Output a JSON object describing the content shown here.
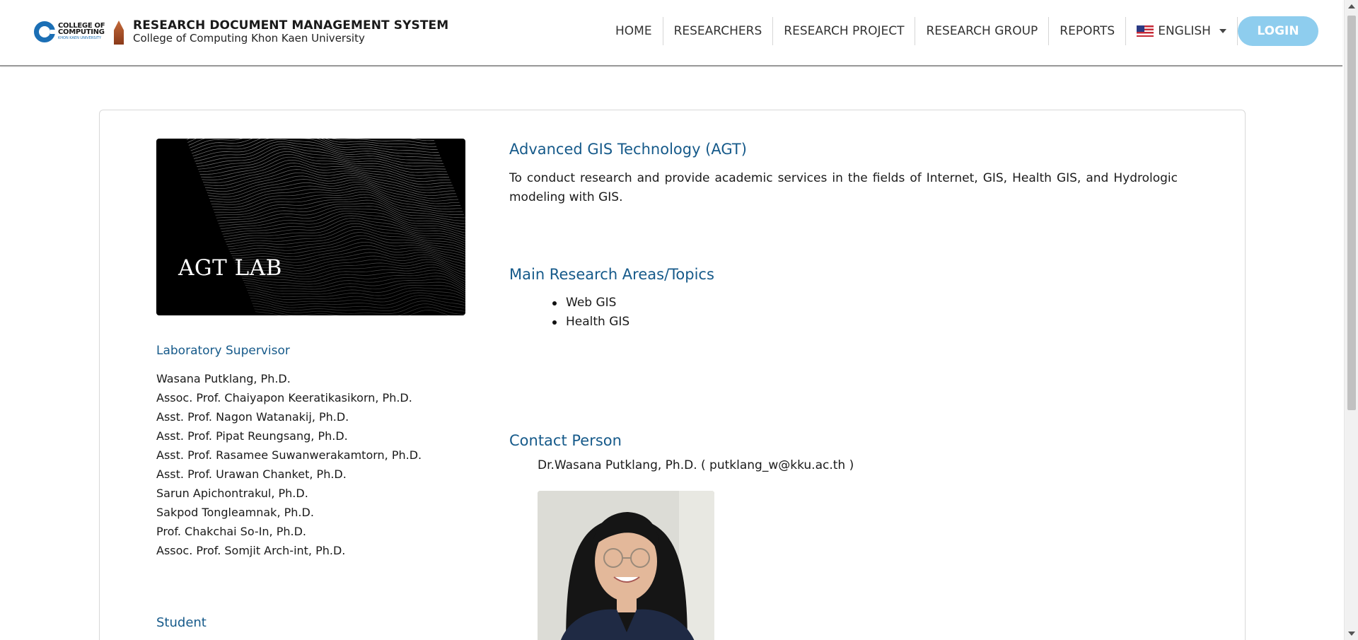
{
  "header": {
    "logo_line1": "COLLEGE OF",
    "logo_line2": "COMPUTING",
    "logo_line3": "KHON KAEN UNIVERSITY",
    "title": "RESEARCH DOCUMENT MANAGEMENT SYSTEM",
    "subtitle": "College of Computing Khon Kaen University"
  },
  "nav": {
    "items": [
      {
        "label": "HOME"
      },
      {
        "label": "RESEARCHERS"
      },
      {
        "label": "RESEARCH PROJECT"
      },
      {
        "label": "RESEARCH GROUP"
      },
      {
        "label": "REPORTS"
      }
    ],
    "language": "ENGLISH",
    "login": "LOGIN"
  },
  "lab": {
    "image_caption": "AGT LAB",
    "supervisor_heading": "Laboratory Supervisor",
    "supervisors": [
      "Wasana Putklang, Ph.D.",
      "Assoc. Prof. Chaiyapon Keeratikasikorn, Ph.D.",
      "Asst. Prof. Nagon Watanakij, Ph.D.",
      "Asst. Prof. Pipat Reungsang, Ph.D.",
      "Asst. Prof. Rasamee Suwanwerakamtorn, Ph.D.",
      "Asst. Prof. Urawan Chanket, Ph.D.",
      "Sarun Apichontrakul, Ph.D.",
      "Sakpod Tongleamnak, Ph.D.",
      "Prof. Chakchai So-In, Ph.D.",
      "Assoc. Prof. Somjit Arch-int, Ph.D."
    ],
    "student_heading": "Student"
  },
  "group": {
    "title": "Advanced GIS Technology (AGT)",
    "description": "To conduct research and provide academic services in the fields of Internet, GIS, Health GIS, and Hydrologic modeling with GIS.",
    "areas_heading": "Main Research Areas/Topics",
    "areas": [
      "Web GIS",
      "Health GIS"
    ],
    "contact_heading": "Contact Person",
    "contact": "Dr.Wasana Putklang, Ph.D. ( putklang_w@kku.ac.th )"
  },
  "colors": {
    "heading": "#165a8a",
    "login_button": "#8ecdee",
    "navbar_border": "#9a9a9a"
  }
}
